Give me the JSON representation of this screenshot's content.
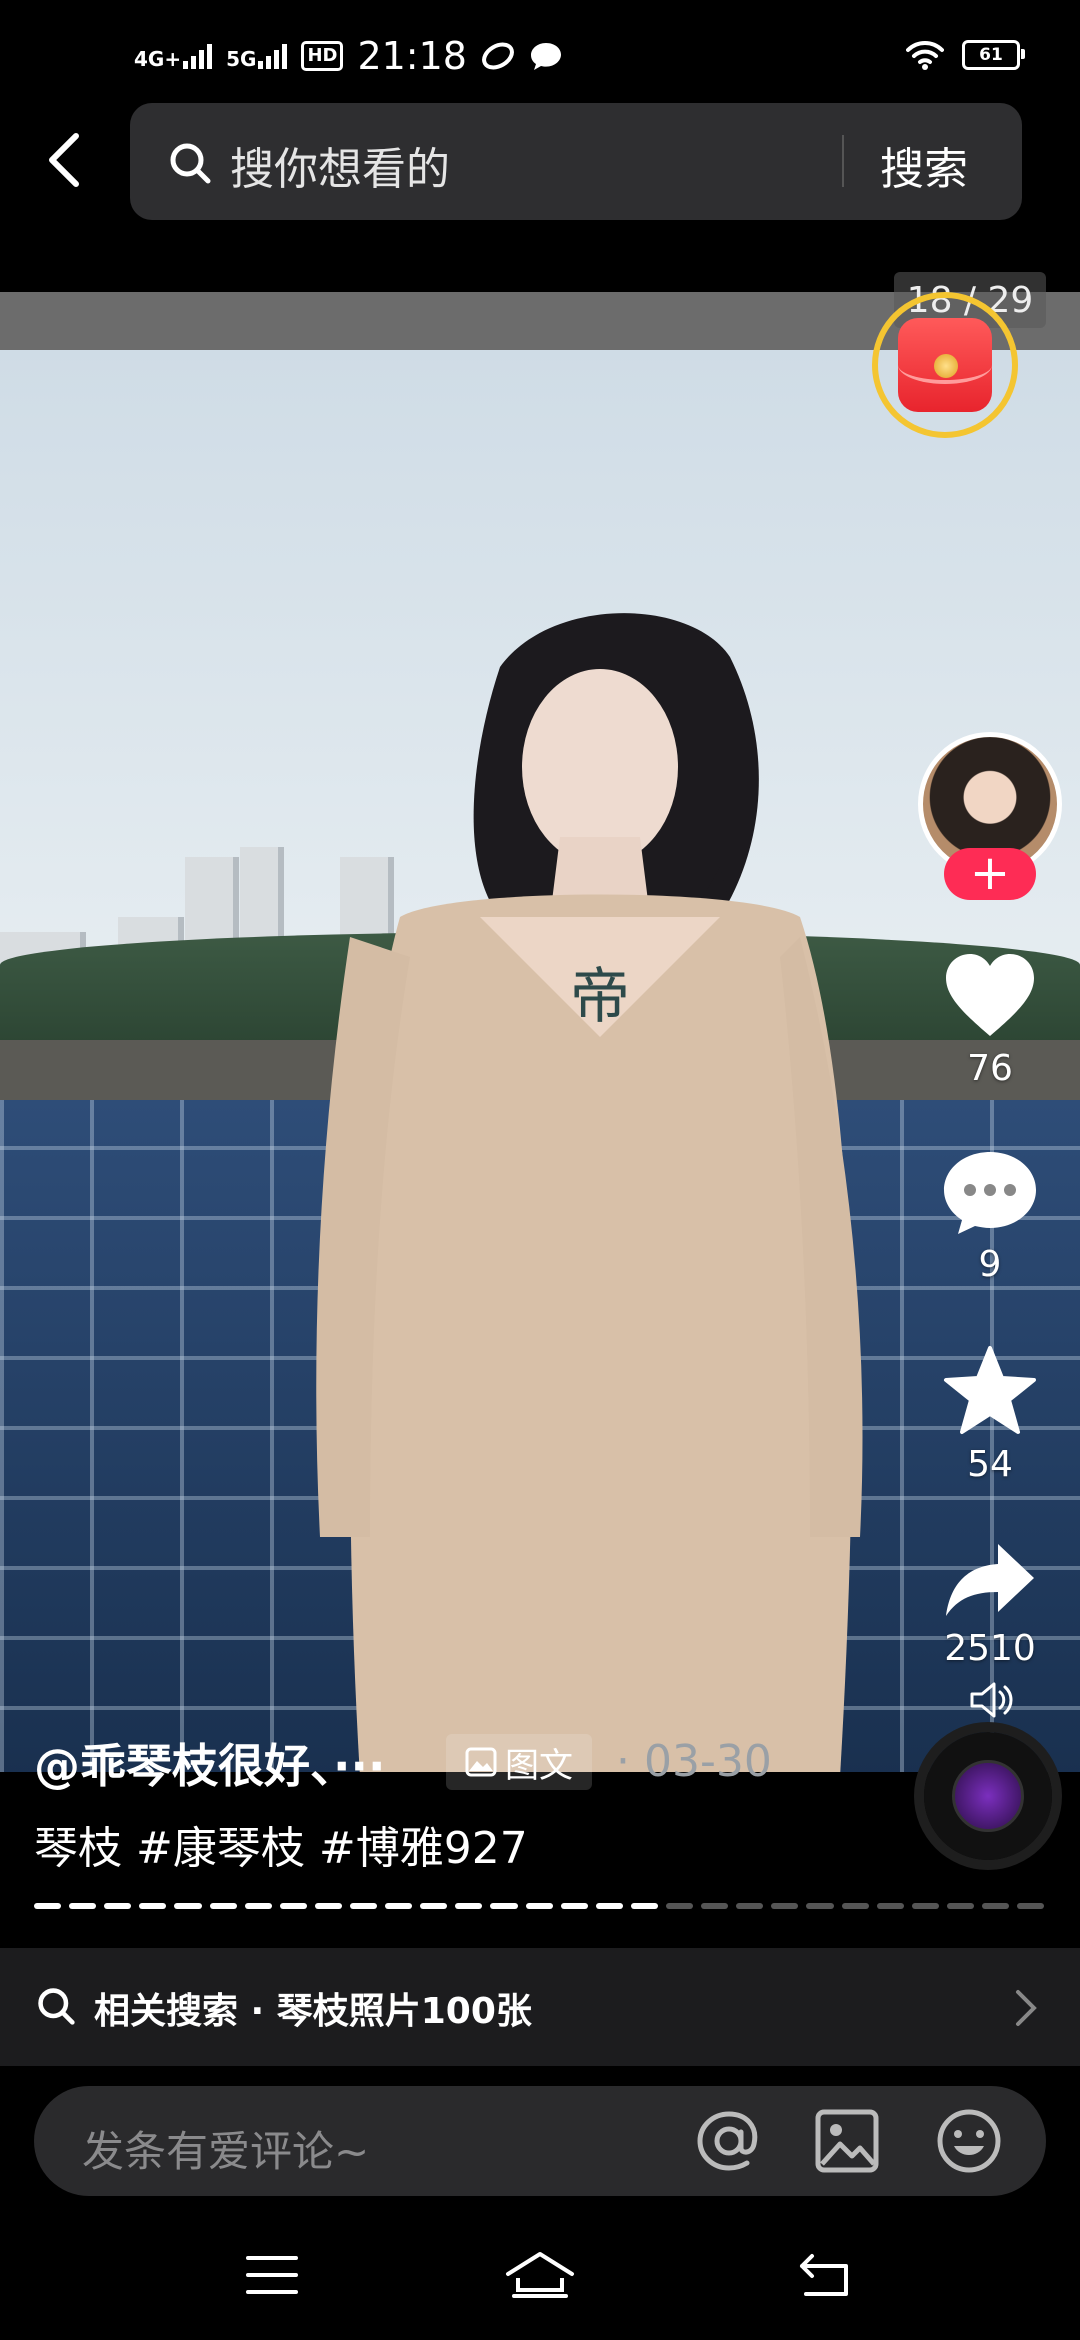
{
  "status_bar": {
    "network_1": "4G+",
    "network_2": "5G",
    "hd": "HD",
    "time": "21:18",
    "battery": "61"
  },
  "search": {
    "placeholder": "搜你想看的",
    "button_label": "搜索"
  },
  "post": {
    "image_counter": "18 / 29",
    "author": "@乖琴枝很好、···",
    "type_tag": "图文",
    "date": "03-30",
    "caption": "琴枝 #康琴枝 #博雅927",
    "progress": {
      "current": 18,
      "total": 29
    }
  },
  "actions": {
    "likes": "76",
    "comments": "9",
    "favorites": "54",
    "shares": "2510"
  },
  "related": {
    "label": "相关搜索 · 琴枝照片100张"
  },
  "comment": {
    "placeholder": "发条有爱评论~"
  },
  "colors": {
    "accent_red": "#fe2c55",
    "ring_yellow": "#f4c531",
    "background": "#000000"
  },
  "icons": [
    "back-icon",
    "search-icon",
    "heart-icon",
    "comment-icon",
    "star-icon",
    "share-icon",
    "volume-icon",
    "at-icon",
    "image-icon",
    "emoji-icon",
    "menu-icon",
    "home-icon",
    "return-icon",
    "chevron-right-icon"
  ]
}
